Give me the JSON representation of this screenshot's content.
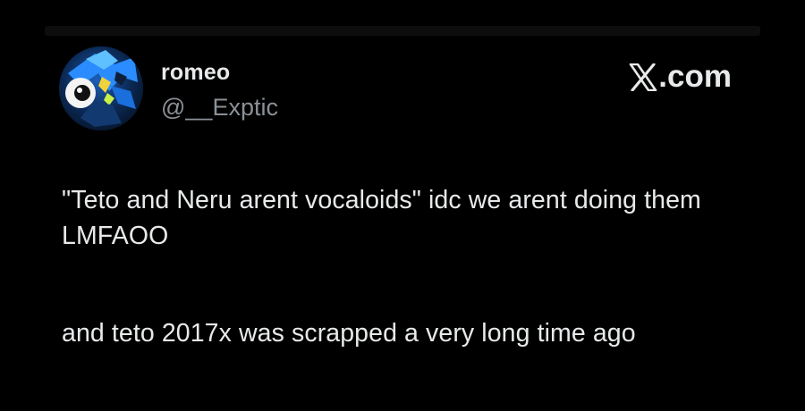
{
  "post": {
    "author": {
      "display_name": "romeo",
      "handle": "@__Exptic",
      "avatar_icon": "anime-avatar-icon"
    },
    "brand": {
      "label": ".com",
      "logo_icon": "x-logo-icon"
    },
    "paragraphs": [
      "\"Teto and Neru arent vocaloids\" idc we arent doing them LMFAOO",
      "and teto 2017x was scrapped a very long time ago"
    ]
  },
  "colors": {
    "background": "#000000",
    "text_primary": "#e7e9ea",
    "text_secondary": "#8b9096",
    "avatar_accent": "#3aa0ff"
  }
}
